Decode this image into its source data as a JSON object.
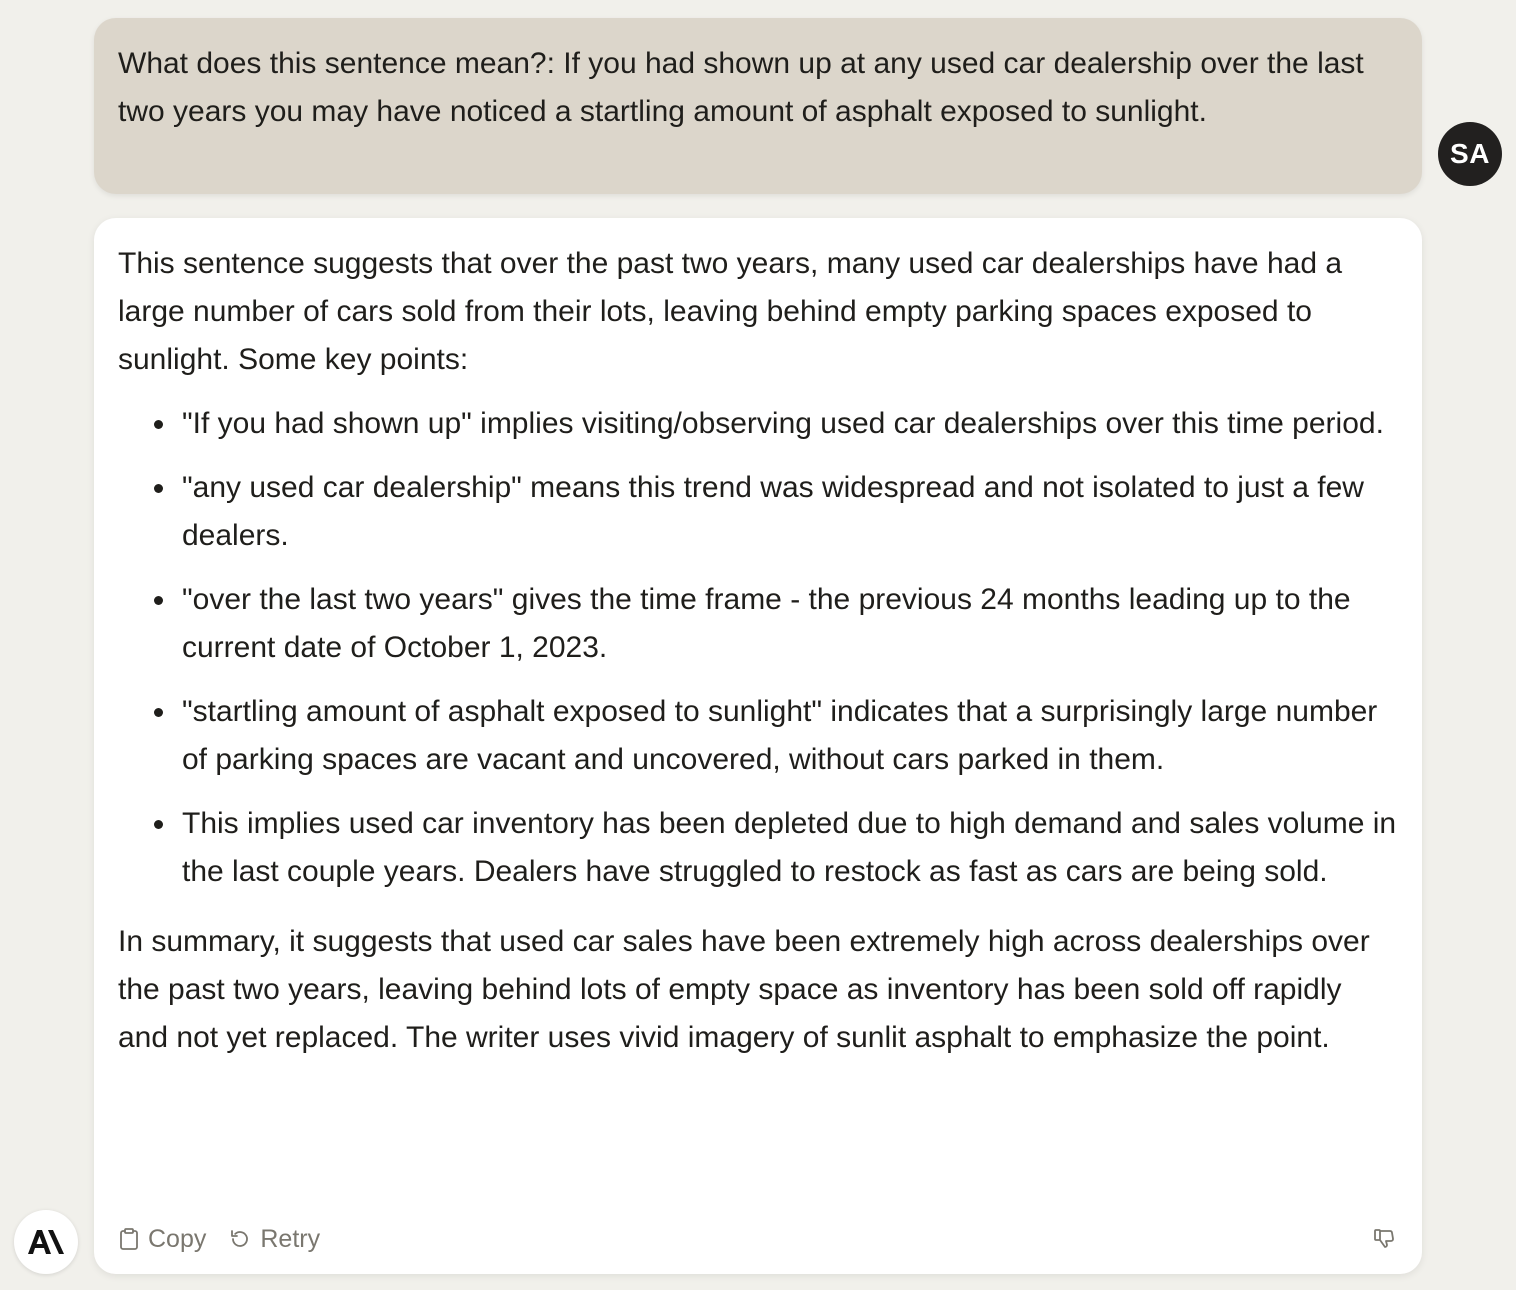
{
  "user": {
    "avatar_initials": "SA",
    "message": "What does this sentence mean?: If you had shown up at any used car dealership over the last two years you may have noticed a startling amount of asphalt exposed to sunlight."
  },
  "assistant": {
    "intro": "This sentence suggests that over the past two years, many used car dealerships have had a large number of cars sold from their lots, leaving behind empty parking spaces exposed to sunlight. Some key points:",
    "bullets": [
      "\"If you had shown up\" implies visiting/observing used car dealerships over this time period.",
      "\"any used car dealership\" means this trend was widespread and not isolated to just a few dealers.",
      "\"over the last two years\" gives the time frame - the previous 24 months leading up to the current date of October 1, 2023.",
      "\"startling amount of asphalt exposed to sunlight\" indicates that a surprisingly large number of parking spaces are vacant and uncovered, without cars parked in them.",
      "This implies used car inventory has been depleted due to high demand and sales volume in the last couple years. Dealers have struggled to restock as fast as cars are being sold."
    ],
    "summary": "In summary, it suggests that used car sales have been extremely high across dealerships over the past two years, leaving behind lots of empty space as inventory has been sold off rapidly and not yet replaced. The writer uses vivid imagery of sunlit asphalt to emphasize the point."
  },
  "actions": {
    "copy_label": "Copy",
    "retry_label": "Retry",
    "copy_icon": "clipboard-icon",
    "retry_icon": "retry-icon",
    "feedback_icon": "thumbs-down-icon"
  },
  "logo": {
    "text": "A\\"
  },
  "colors": {
    "background": "#f1f0eb",
    "user_bubble": "#dcd6cb",
    "assistant_bubble": "#ffffff",
    "avatar_bg": "#22201f",
    "muted_text": "#7a776f"
  }
}
